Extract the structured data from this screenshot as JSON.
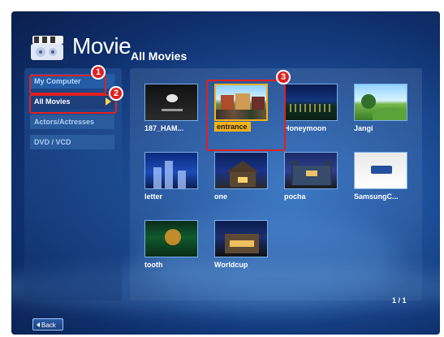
{
  "header": {
    "app_title": "Movie",
    "page_title": "All Movies"
  },
  "sidebar": {
    "items": [
      {
        "label": "My Computer",
        "state": "default"
      },
      {
        "label": "All Movies",
        "state": "active"
      },
      {
        "label": "Actors/Actresses",
        "state": "default"
      },
      {
        "label": "DVD / VCD",
        "state": "default"
      }
    ]
  },
  "grid": {
    "tiles": [
      {
        "caption": "187_HAM...",
        "thumb": "dark-logo"
      },
      {
        "caption": "entrance",
        "thumb": "market-scene",
        "selected": true
      },
      {
        "caption": "Honeymoon",
        "thumb": "night-landscape"
      },
      {
        "caption": "Jangi",
        "thumb": "green-hills"
      },
      {
        "caption": "letter",
        "thumb": "city-towers"
      },
      {
        "caption": "one",
        "thumb": "night-house"
      },
      {
        "caption": "pocha",
        "thumb": "castle-night"
      },
      {
        "caption": "SamsungC...",
        "thumb": "white-logo"
      },
      {
        "caption": "tooth",
        "thumb": "forest-lantern"
      },
      {
        "caption": "Worldcup",
        "thumb": "lit-house"
      }
    ]
  },
  "pager": {
    "text": "1 / 1"
  },
  "footer": {
    "back_label": "Back"
  },
  "annotations": {
    "badge1": "1",
    "badge2": "2",
    "badge3": "3",
    "color": "#e02020"
  }
}
